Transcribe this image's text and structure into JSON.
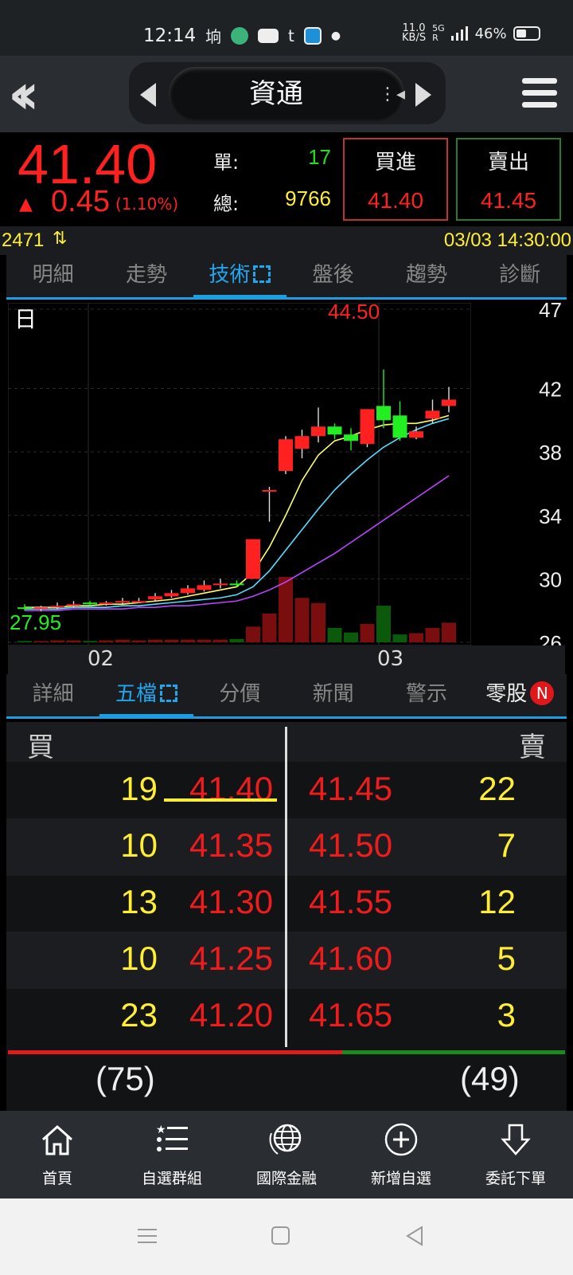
{
  "status_bar": {
    "time": "12:14",
    "network_speed": "11.0",
    "network_unit": "KB/S",
    "network_type": "5G",
    "battery": "46%",
    "battery_level": 0.46
  },
  "header": {
    "title": "資通"
  },
  "quote": {
    "price": "41.40",
    "change": "0.45",
    "change_pct": "(1.10%)",
    "unit_label": "單:",
    "unit_value": "17",
    "total_label": "總:",
    "total_value": "9766",
    "buy_label": "買進",
    "buy_price": "41.40",
    "sell_label": "賣出",
    "sell_price": "41.45"
  },
  "info": {
    "code": "2471",
    "datetime": "03/03 14:30:00"
  },
  "tabs_top": [
    "明細",
    "走勢",
    "技術",
    "盤後",
    "趨勢",
    "診斷"
  ],
  "tabs_top_active": 2,
  "chart_data": {
    "type": "candlestick",
    "period_label": "日",
    "y_ticks": [
      "47",
      "42",
      "38",
      "34",
      "30",
      "26"
    ],
    "ylim": [
      26,
      47
    ],
    "high_label": "44.50",
    "low_label": "27.95",
    "x_ticks": [
      "02",
      "03"
    ],
    "candles": [
      {
        "o": 28.2,
        "c": 28.1,
        "h": 28.4,
        "l": 28.0
      },
      {
        "o": 28.1,
        "c": 28.2,
        "h": 28.3,
        "l": 27.95
      },
      {
        "o": 28.2,
        "c": 28.3,
        "h": 28.5,
        "l": 28.1
      },
      {
        "o": 28.3,
        "c": 28.4,
        "h": 28.6,
        "l": 28.2
      },
      {
        "o": 28.5,
        "c": 28.4,
        "h": 28.6,
        "l": 28.3
      },
      {
        "o": 28.4,
        "c": 28.5,
        "h": 28.6,
        "l": 28.3
      },
      {
        "o": 28.5,
        "c": 28.6,
        "h": 28.8,
        "l": 28.4
      },
      {
        "o": 28.6,
        "c": 28.6,
        "h": 28.8,
        "l": 28.5
      },
      {
        "o": 28.7,
        "c": 28.9,
        "h": 29.1,
        "l": 28.6
      },
      {
        "o": 28.9,
        "c": 29.1,
        "h": 29.3,
        "l": 28.8
      },
      {
        "o": 29.1,
        "c": 29.4,
        "h": 29.6,
        "l": 29.0
      },
      {
        "o": 29.3,
        "c": 29.6,
        "h": 29.9,
        "l": 29.2
      },
      {
        "o": 29.6,
        "c": 29.7,
        "h": 30.0,
        "l": 29.4
      },
      {
        "o": 29.7,
        "c": 29.6,
        "h": 29.9,
        "l": 29.5
      },
      {
        "o": 30.0,
        "c": 32.5,
        "h": 32.5,
        "l": 30.0
      },
      {
        "o": 35.6,
        "c": 35.6,
        "h": 35.8,
        "l": 33.6
      },
      {
        "o": 36.8,
        "c": 38.8,
        "h": 39.0,
        "l": 36.6
      },
      {
        "o": 38.2,
        "c": 39.0,
        "h": 39.4,
        "l": 37.6
      },
      {
        "o": 39.0,
        "c": 39.6,
        "h": 40.8,
        "l": 38.6
      },
      {
        "o": 39.6,
        "c": 39.1,
        "h": 39.8,
        "l": 38.8
      },
      {
        "o": 39.1,
        "c": 38.7,
        "h": 39.5,
        "l": 38.1
      },
      {
        "o": 38.5,
        "c": 40.7,
        "h": 40.7,
        "l": 38.3
      },
      {
        "o": 40.9,
        "c": 40.0,
        "h": 43.2,
        "l": 39.5
      },
      {
        "o": 40.3,
        "c": 38.9,
        "h": 41.2,
        "l": 38.7
      },
      {
        "o": 38.9,
        "c": 39.3,
        "h": 39.6,
        "l": 38.8
      },
      {
        "o": 40.1,
        "c": 40.6,
        "h": 41.3,
        "l": 39.8
      },
      {
        "o": 40.9,
        "c": 41.3,
        "h": 42.1,
        "l": 40.5
      }
    ],
    "ma_series": [
      {
        "color": "#ffff66",
        "values": [
          28.2,
          28.2,
          28.2,
          28.3,
          28.3,
          28.4,
          28.4,
          28.5,
          28.6,
          28.7,
          28.9,
          29.1,
          29.3,
          29.5,
          30.4,
          32.0,
          34.0,
          36.2,
          37.8,
          38.7,
          39.0,
          39.4,
          39.7,
          39.8,
          39.8,
          40.0,
          40.3
        ]
      },
      {
        "color": "#55ddff",
        "values": [
          28.1,
          28.1,
          28.1,
          28.2,
          28.2,
          28.2,
          28.3,
          28.3,
          28.4,
          28.5,
          28.6,
          28.7,
          28.8,
          29.0,
          29.5,
          30.5,
          31.8,
          33.1,
          34.4,
          35.6,
          36.6,
          37.5,
          38.3,
          38.9,
          39.4,
          39.8,
          40.1
        ]
      },
      {
        "color": "#bb44ff",
        "values": [
          28.0,
          28.0,
          28.0,
          28.1,
          28.1,
          28.1,
          28.1,
          28.2,
          28.2,
          28.3,
          28.3,
          28.4,
          28.5,
          28.6,
          28.9,
          29.3,
          29.8,
          30.4,
          31.0,
          31.6,
          32.3,
          33.0,
          33.7,
          34.4,
          35.1,
          35.8,
          36.5
        ]
      }
    ],
    "volume": [
      2,
      2,
      3,
      3,
      2,
      3,
      4,
      3,
      4,
      4,
      4,
      4,
      4,
      5,
      24,
      44,
      100,
      68,
      60,
      22,
      15,
      28,
      56,
      12,
      14,
      22,
      30
    ]
  },
  "tabs_bottom": [
    "詳細",
    "五檔",
    "分價",
    "新聞",
    "警示",
    "零股"
  ],
  "tabs_bottom_active": 1,
  "badge_new": "N",
  "order_book": {
    "buy_header": "買",
    "sell_header": "賣",
    "rows": [
      {
        "bid_qty": "19",
        "bid": "41.40",
        "ask": "41.45",
        "ask_qty": "22"
      },
      {
        "bid_qty": "10",
        "bid": "41.35",
        "ask": "41.50",
        "ask_qty": "7"
      },
      {
        "bid_qty": "13",
        "bid": "41.30",
        "ask": "41.55",
        "ask_qty": "12"
      },
      {
        "bid_qty": "10",
        "bid": "41.25",
        "ask": "41.60",
        "ask_qty": "5"
      },
      {
        "bid_qty": "23",
        "bid": "41.20",
        "ask": "41.65",
        "ask_qty": "3"
      }
    ],
    "buy_total": "(75)",
    "sell_total": "(49)",
    "buy_ratio": 0.6
  },
  "bottom_nav": [
    {
      "label": "首頁",
      "icon": "home-icon"
    },
    {
      "label": "自選群組",
      "icon": "list-star-icon"
    },
    {
      "label": "國際金融",
      "icon": "globe-icon"
    },
    {
      "label": "新增自選",
      "icon": "plus-circle-icon"
    },
    {
      "label": "委託下單",
      "icon": "arrow-down-icon"
    }
  ],
  "colors": {
    "up": "#ff2020",
    "down": "#22ee22",
    "accent": "#1ea7ef",
    "qty": "#ffee33"
  }
}
